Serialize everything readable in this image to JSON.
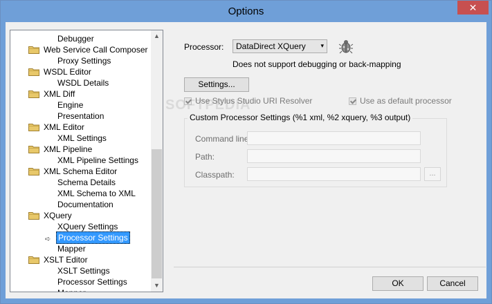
{
  "window": {
    "title": "Options",
    "close_glyph": "✕"
  },
  "tree": {
    "items": [
      {
        "label": "Debugger",
        "level": 1,
        "folder": false
      },
      {
        "label": "Web Service Call Composer",
        "level": 0,
        "folder": true
      },
      {
        "label": "Proxy Settings",
        "level": 1,
        "folder": false
      },
      {
        "label": "WSDL Editor",
        "level": 0,
        "folder": true
      },
      {
        "label": "WSDL Details",
        "level": 1,
        "folder": false
      },
      {
        "label": "XML Diff",
        "level": 0,
        "folder": true
      },
      {
        "label": "Engine",
        "level": 1,
        "folder": false
      },
      {
        "label": "Presentation",
        "level": 1,
        "folder": false
      },
      {
        "label": "XML Editor",
        "level": 0,
        "folder": true
      },
      {
        "label": "XML Settings",
        "level": 1,
        "folder": false
      },
      {
        "label": "XML Pipeline",
        "level": 0,
        "folder": true
      },
      {
        "label": "XML Pipeline Settings",
        "level": 1,
        "folder": false
      },
      {
        "label": "XML Schema Editor",
        "level": 0,
        "folder": true
      },
      {
        "label": "Schema Details",
        "level": 1,
        "folder": false
      },
      {
        "label": "XML Schema to XML",
        "level": 1,
        "folder": false
      },
      {
        "label": "Documentation",
        "level": 1,
        "folder": false
      },
      {
        "label": "XQuery",
        "level": 0,
        "folder": true
      },
      {
        "label": "XQuery Settings",
        "level": 1,
        "folder": false
      },
      {
        "label": "Processor Settings",
        "level": 1,
        "folder": false,
        "selected": true
      },
      {
        "label": "Mapper",
        "level": 1,
        "folder": false
      },
      {
        "label": "XSLT Editor",
        "level": 0,
        "folder": true
      },
      {
        "label": "XSLT Settings",
        "level": 1,
        "folder": false
      },
      {
        "label": "Processor Settings",
        "level": 1,
        "folder": false
      },
      {
        "label": "Mapper",
        "level": 1,
        "folder": false
      }
    ],
    "scroll_up_glyph": "▲",
    "scroll_down_glyph": "▼"
  },
  "processor": {
    "label": "Processor:",
    "value": "DataDirect XQuery",
    "caret": "▾",
    "note": "Does not support debugging or back-mapping",
    "icon": "debug-bug-icon"
  },
  "settings_button": "Settings...",
  "use_uri_resolver": {
    "label": "Use Stylus Studio URI Resolver",
    "checked": true,
    "disabled": true
  },
  "use_default": {
    "label": "Use as default processor",
    "checked": true,
    "disabled": true
  },
  "custom_group": {
    "title": "Custom Processor Settings (%1 xml, %2 xquery, %3 output)",
    "command_line_label": "Command line:",
    "command_line_value": "",
    "path_label": "Path:",
    "path_value": "",
    "classpath_label": "Classpath:",
    "classpath_value": "",
    "browse_label": "..."
  },
  "footer": {
    "ok": "OK",
    "cancel": "Cancel"
  },
  "watermark": "SOFTPEDIA",
  "colors": {
    "titlebar": "#6f9fd8",
    "close": "#c75050",
    "selection": "#3399ff"
  }
}
